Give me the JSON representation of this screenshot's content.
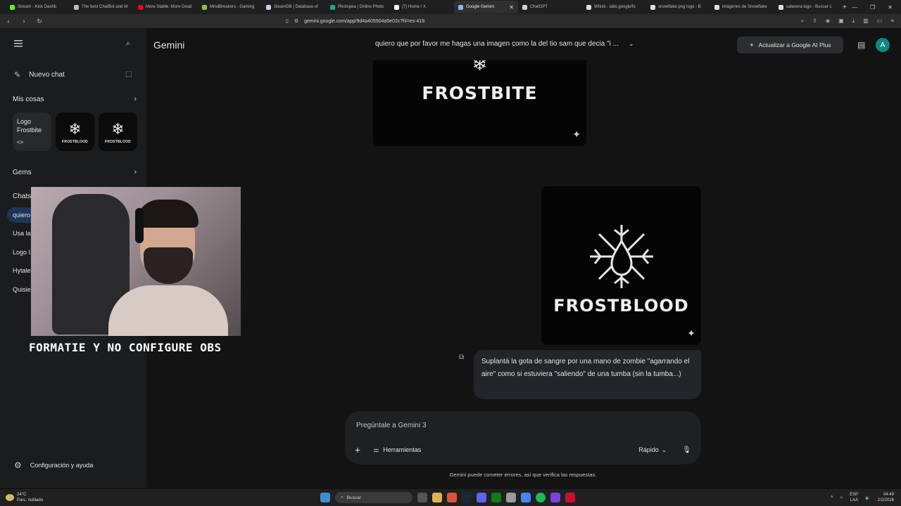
{
  "browser": {
    "tabs": [
      {
        "label": "Stream - Kick Dashb",
        "color": "#53fc18"
      },
      {
        "label": "The best ChatBot and W",
        "color": "#bdbdbd"
      },
      {
        "label": "More Stable. More Dead",
        "color": "#ff0000"
      },
      {
        "label": "MindBreakers - Gaming",
        "color": "#8bc34a"
      },
      {
        "label": "SteamDB | Database of",
        "color": "#c6d4df"
      },
      {
        "label": "Photopea | Online Photo",
        "color": "#18a497"
      },
      {
        "label": "(7) Home / X",
        "color": "#ffffff"
      },
      {
        "label": "Google Gemini",
        "color": "#8ab4f8",
        "active": true
      },
      {
        "label": "ChatGPT",
        "color": "#d0d0d0"
      },
      {
        "label": "Whisk - labs.google/fx",
        "color": "#e0e0e0"
      },
      {
        "label": "snowflake png logo - B",
        "color": "#e0e0e0"
      },
      {
        "label": "imágenes de Snowflake",
        "color": "#e0e0e0"
      },
      {
        "label": "calavera logo - Buscar c",
        "color": "#e0e0e0"
      }
    ],
    "url": "gemini.google.com/app/9d4a405504a5e02c?hl=es-419"
  },
  "sidebar": {
    "new_chat": "Nuevo chat",
    "my_stuff": "Mis cosas",
    "thumb_text_1": "Logo",
    "thumb_text_2": "Frostbite",
    "thumb_code": "<>",
    "thumb_logo_label": "FROSTBLOOD",
    "gems": "Gems",
    "chats_heading": "Chats",
    "chats": [
      "quiero",
      "Usa la",
      "Logo I",
      "Hytale",
      "Quisie"
    ],
    "settings": "Configuración y ayuda"
  },
  "header": {
    "brand": "Gemini",
    "conversation_title": "quiero que por favor me hagas una imagen como la del tio sam que decia \"i ...",
    "upgrade": "Actualizar a Google AI Plus",
    "avatar_letter": "A"
  },
  "chat": {
    "image1_text": "FROSTBITE",
    "image2_text": "FROSTBLOOD",
    "user_message": "Suplantá la gota de sangre por una mano de zombie \"agarrando el aire\" como si estuviera \"saliendo\" de una tumba (sin la tumba...)"
  },
  "composer": {
    "placeholder": "Pregúntale a Gemini 3",
    "tools": "Herramientas",
    "model": "Rápido"
  },
  "disclaimer": "Gemini puede cometer errores, así que verifica las respuestas.",
  "overlay": {
    "caption": "FORMATIE Y NO CONFIGURE OBS"
  },
  "taskbar": {
    "temperature": "24°C",
    "weather": "Parc. nublado",
    "search": "Buscar",
    "lang_1": "ESP",
    "lang_2": "LAA",
    "time": "04:49",
    "date": "2/2/2026"
  },
  "colors": {
    "accent": "#8ab4f8",
    "active_chat": "#1e3557",
    "avatar": "#0e8a7d"
  }
}
